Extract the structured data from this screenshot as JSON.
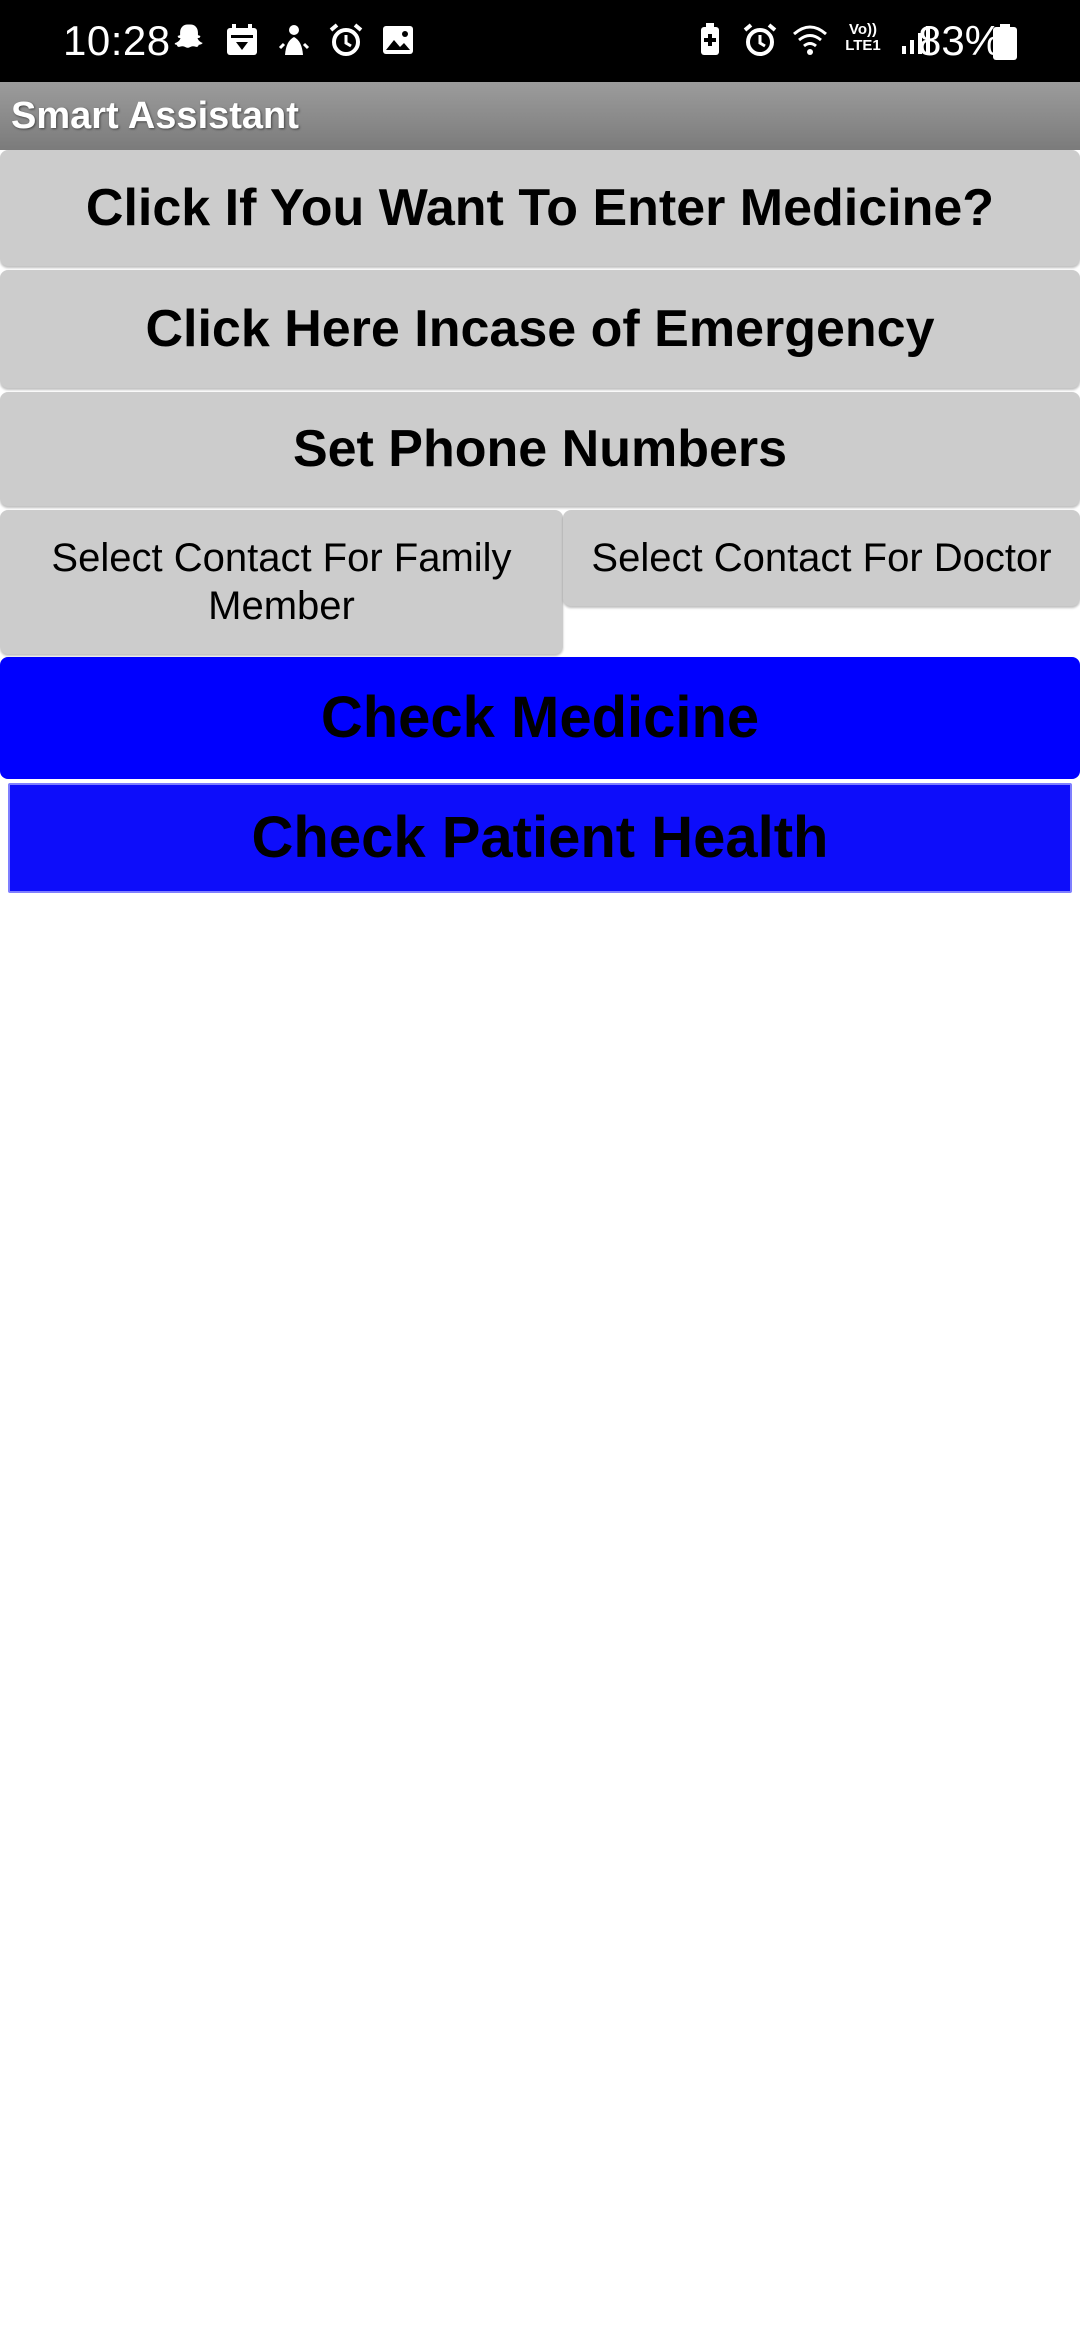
{
  "status_bar": {
    "time": "10:28",
    "battery_percent": "83%",
    "lte_line1": "Vo))",
    "lte_line2": "LTE1",
    "left_icons": [
      "snapchat-icon",
      "gallery-calendar-icon",
      "notification-icon",
      "alarm-icon",
      "image-icon"
    ],
    "right_icons": [
      "battery-saver-icon",
      "alarm-icon",
      "wifi-icon",
      "volte-icon",
      "signal-icon",
      "battery-icon"
    ]
  },
  "app_bar": {
    "title": "Smart Assistant"
  },
  "buttons": {
    "enter_medicine": "Click If You Want To Enter Medicine?",
    "emergency": "Click Here Incase of Emergency",
    "set_phone_numbers": "Set Phone Numbers",
    "select_family": "Select Contact For Family Member",
    "select_doctor": "Select Contact For Doctor",
    "check_medicine": "Check Medicine",
    "check_patient_health": "Check Patient Health"
  },
  "colors": {
    "status_bar_bg": "#000000",
    "title_bar_bg": "#8a8a8a",
    "gray_button": "#cccccc",
    "blue_button": "#0000ff",
    "page_bg": "#ffffff"
  }
}
